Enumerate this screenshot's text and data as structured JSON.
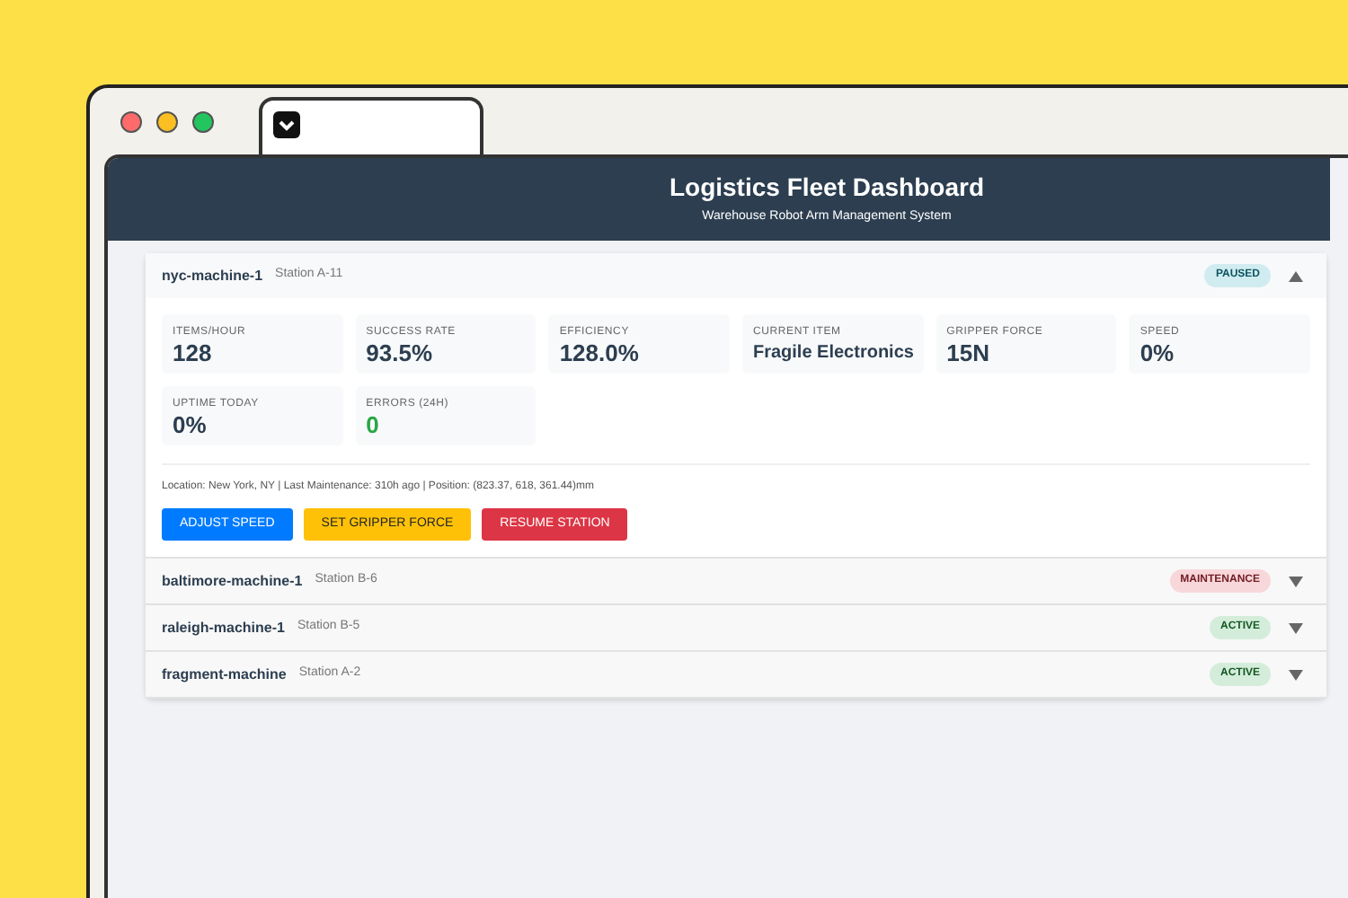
{
  "header": {
    "title": "Logistics Fleet Dashboard",
    "subtitle": "Warehouse Robot Arm Management System"
  },
  "machines": [
    {
      "name": "nyc-machine-1",
      "station": "Station A-11",
      "status": "PAUSED",
      "color": "#d1ecf1",
      "expanded": true,
      "metrics": [
        {
          "label": "ITEMS/HOUR",
          "value": "128",
          "kind": "number"
        },
        {
          "label": "SUCCESS RATE",
          "value": "93.5%",
          "kind": "number"
        },
        {
          "label": "EFFICIENCY",
          "value": "128.0%",
          "kind": "number"
        },
        {
          "label": "CURRENT ITEM",
          "value": "Fragile Electronics",
          "kind": "text"
        },
        {
          "label": "GRIPPER FORCE",
          "value": "15N",
          "kind": "number"
        },
        {
          "label": "SPEED",
          "value": "0%",
          "kind": "number"
        },
        {
          "label": "UPTIME TODAY",
          "value": "0%",
          "kind": "number"
        },
        {
          "label": "ERRORS (24H)",
          "value": "0",
          "kind": "good"
        }
      ],
      "info": "Location: New York, NY | Last Maintenance: 310h ago | Position: (823.37, 618, 361.44)mm",
      "buttons": [
        {
          "label": "ADJUST SPEED",
          "kind": "primary"
        },
        {
          "label": "SET GRIPPER FORCE",
          "kind": "warning"
        },
        {
          "label": "RESUME STATION",
          "kind": "danger"
        }
      ]
    },
    {
      "name": "baltimore-machine-1",
      "station": "Station B-6",
      "status": "MAINTENANCE",
      "color": "#f8d7da",
      "expanded": false
    },
    {
      "name": "raleigh-machine-1",
      "station": "Station B-5",
      "status": "ACTIVE",
      "color": "#d4edda",
      "expanded": false
    },
    {
      "name": "fragment-machine",
      "station": "Station A-2",
      "status": "ACTIVE",
      "color": "#d4edda",
      "expanded": false
    }
  ]
}
